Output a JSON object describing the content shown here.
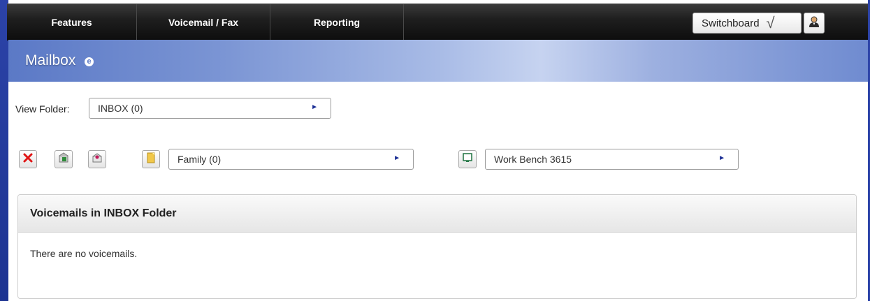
{
  "nav": {
    "items": [
      {
        "label": "Features"
      },
      {
        "label": "Voicemail / Fax"
      },
      {
        "label": "Reporting"
      }
    ],
    "switchboard_label": "Switchboard",
    "check_glyph": "√"
  },
  "banner": {
    "title": "Mailbox",
    "help_glyph": "e"
  },
  "view_folder": {
    "label": "View Folder:",
    "value": "INBOX (0)"
  },
  "toolbar": {
    "icons": [
      "delete-icon",
      "save-voicemail-icon",
      "open-voicemail-icon",
      "note-icon",
      "monitor-icon"
    ],
    "family_value": "Family (0)",
    "bench_value": "Work Bench 3615"
  },
  "panel": {
    "title": "Voicemails in INBOX Folder",
    "empty_text": "There are no voicemails."
  },
  "colors": {
    "brand_blue": "#2c43a8",
    "nav_dark": "#1f1f1f",
    "arrow_blue": "#1c2f95",
    "delete_red": "#e01414"
  }
}
